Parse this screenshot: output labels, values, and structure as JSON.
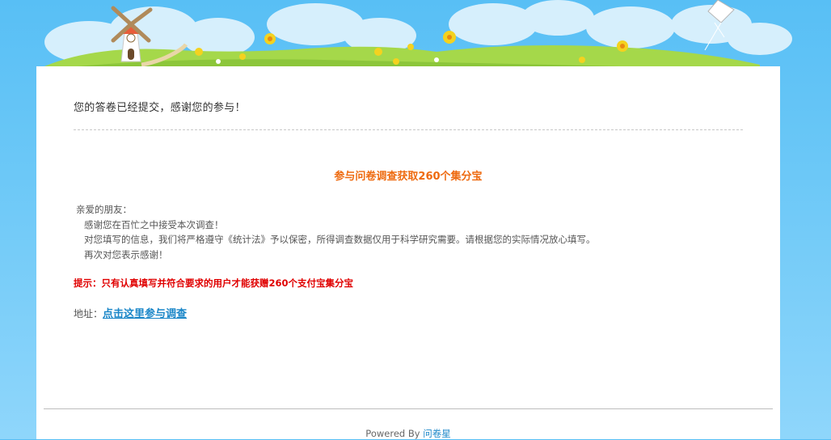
{
  "confirmation": {
    "message": "您的答卷已经提交，感谢您的参与！"
  },
  "promo": {
    "title": "参与问卷调查获取260个集分宝"
  },
  "letter": {
    "greeting": "亲爱的朋友：",
    "line1": "感谢您在百忙之中接受本次调查！",
    "line2": "对您填写的信息，我们将严格遵守《统计法》予以保密，所得调查数据仅用于科学研究需要。请根据您的实际情况放心填写。",
    "line3": "再次对您表示感谢！"
  },
  "tip": {
    "text": "提示：只有认真填写并符合要求的用户才能获赠260个支付宝集分宝"
  },
  "address": {
    "label": "地址：",
    "link_text": "点击这里参与调查"
  },
  "footer": {
    "powered_by": "Powered By",
    "brand": "问卷星"
  },
  "colors": {
    "sky": "#58bff5",
    "grass": "#a5d84a",
    "promo_orange": "#ee6a0f",
    "tip_red": "#e00000",
    "link_blue": "#1a86c8"
  },
  "icons": {
    "windmill": "windmill-icon",
    "kite": "kite-icon",
    "flowers": "flower-icon"
  }
}
